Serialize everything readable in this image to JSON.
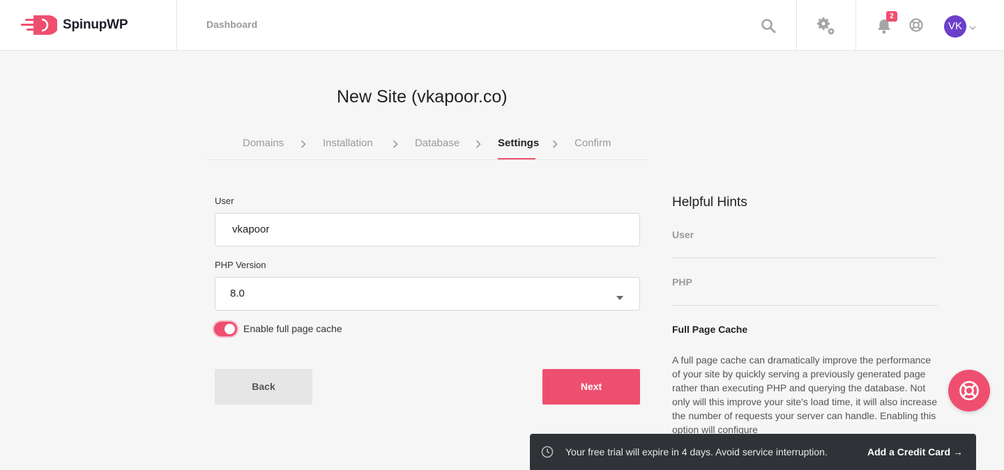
{
  "header": {
    "logo_text": "SpinupWP",
    "nav_dashboard": "Dashboard",
    "notifications_count": "2",
    "avatar_initials": "VK",
    "colors": {
      "brand": "#ef4f6f",
      "avatar": "#6b3fc9"
    }
  },
  "page": {
    "title": "New Site (vkapoor.co)"
  },
  "steps": [
    {
      "label": "Domains",
      "active": false
    },
    {
      "label": "Installation",
      "active": false
    },
    {
      "label": "Database",
      "active": false
    },
    {
      "label": "Settings",
      "active": true
    },
    {
      "label": "Confirm",
      "active": false
    }
  ],
  "form": {
    "user_label": "User",
    "user_value": "vkapoor",
    "php_label": "PHP Version",
    "php_value": "8.0",
    "cache_toggle_label": "Enable full page cache",
    "cache_enabled": true,
    "back_label": "Back",
    "next_label": "Next"
  },
  "hints": {
    "title": "Helpful Hints",
    "items": [
      {
        "label": "User"
      },
      {
        "label": "PHP"
      },
      {
        "label": "Full Page Cache"
      }
    ],
    "full_page_cache_text": "A full page cache can dramatically improve the performance of your site by quickly serving a previously generated page rather than executing PHP and querying the database. Not only will this improve your site's load time, it will also increase the number of requests your server can handle. Enabling this option will configure"
  },
  "trial_bar": {
    "message": "Your free trial will expire in 4 days. Avoid service interruption.",
    "link": "Add a Credit Card →"
  },
  "icons": [
    "search-icon",
    "gear-icon",
    "bell-icon",
    "help-globe-icon",
    "chevron-down-icon",
    "chevron-right-icon",
    "lifebuoy-icon",
    "clock-icon"
  ]
}
